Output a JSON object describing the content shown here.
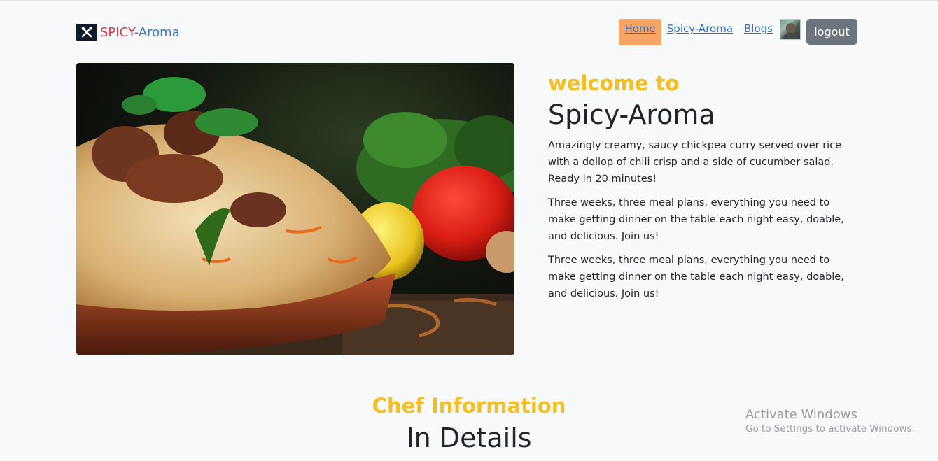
{
  "brand": {
    "spicy": "SPICY",
    "dash": "-",
    "aroma": "Aroma",
    "logo_icon": "utensils-icon"
  },
  "nav": {
    "home": "Home",
    "spicy_aroma": "Spicy-Aroma",
    "blogs": "Blogs",
    "logout": "logout",
    "home_bg": "#f6a566"
  },
  "hero": {
    "welcome": "welcome to",
    "title": "Spicy-Aroma",
    "paragraphs": [
      "Amazingly creamy, saucy chickpea curry served over rice with a dollop of chili crisp and a side of cucumber salad. Ready in 20 minutes!",
      "Three weeks, three meal plans, everything you need to make getting dinner on the table each night easy, doable, and delicious. Join us!",
      "Three weeks, three meal plans, everything you need to make getting dinner on the table each night easy, doable, and delicious. Join us!"
    ]
  },
  "chef": {
    "subtitle": "Chef Information",
    "title": "In Details"
  },
  "watermark": {
    "line1": "Activate Windows",
    "line2": "Go to Settings to activate Windows."
  },
  "colors": {
    "accent_yellow": "#f4bf21",
    "link_blue": "#2f6fc9",
    "logout_gray": "#6c757d",
    "brand_red": "#dc3545"
  }
}
